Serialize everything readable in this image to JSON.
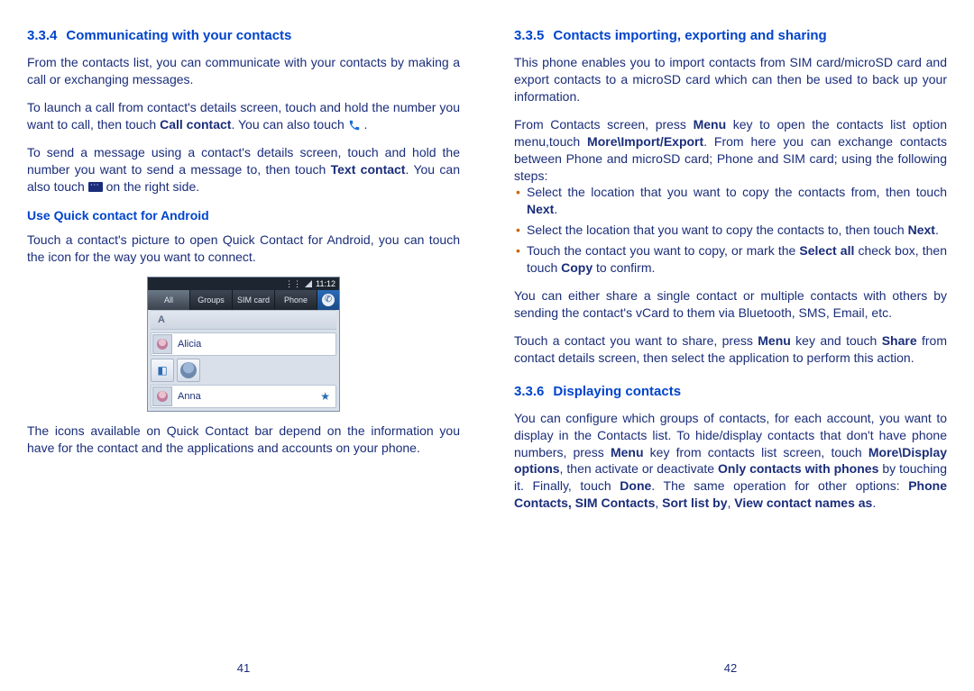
{
  "left": {
    "h_num": "3.3.4",
    "h_title": "Communicating with your contacts",
    "p1": "From the contacts list, you can communicate with your contacts by making a call or exchanging messages.",
    "p2a": "To launch a call from contact's details screen, touch and hold the number you want to call, then touch ",
    "p2b": "Call contact",
    "p2c": ". You can also touch ",
    "p2d": " .",
    "p3a": "To send a message using a contact's details screen, touch and hold the number you want to send a message to, then touch ",
    "p3b": "Text contact",
    "p3c": ". You can also touch ",
    "p3d": " on the right side.",
    "h4": "Use Quick contact for Android",
    "p4": "Touch a contact's picture to open Quick Contact for Android, you can touch the icon for the way you want to connect.",
    "p5": "The icons available on Quick Contact bar depend on the information you have for the contact and the applications and accounts on your phone.",
    "pageno": "41"
  },
  "shot": {
    "time": "11:12",
    "tabs": [
      "All",
      "Groups",
      "SIM card",
      "Phone"
    ],
    "letter": "A",
    "c1": "Alicia",
    "c2": "Anna"
  },
  "right": {
    "h1_num": "3.3.5",
    "h1_title": "Contacts importing, exporting and sharing",
    "p1": "This phone enables you to import contacts from SIM card/microSD card and export contacts to a microSD card which can then be used to back up your information.",
    "p2a": "From Contacts screen, press ",
    "p2b": "Menu",
    "p2c": " key to open the  contacts list option menu,touch ",
    "p2d": "More\\Import/Export",
    "p2e": ". From here you can exchange contacts between Phone and microSD card;  Phone and SIM card; using the  following steps:",
    "b1a": "Select the location that you want to copy the contacts from, then touch ",
    "b1b": "Next",
    "b1c": ".",
    "b2a": "Select the location that you want to copy the contacts to, then touch ",
    "b2b": "Next",
    "b2c": ".",
    "b3a": "Touch the contact you want to copy, or mark the ",
    "b3b": "Select all",
    "b3c": " check box, then touch ",
    "b3d": "Copy",
    "b3e": " to confirm.",
    "p3": "You can either share a single contact or multiple contacts with others by sending the contact's vCard to them via Bluetooth, SMS, Email, etc.",
    "p4a": "Touch a contact you want to share, press ",
    "p4b": "Menu",
    "p4c": " key and touch ",
    "p4d": "Share",
    "p4e": " from contact details screen, then select the application to perform this action.",
    "h2_num": "3.3.6",
    "h2_title": "Displaying contacts",
    "p5a": "You can configure which groups of contacts, for each account, you want to display in the Contacts list. To hide/display contacts that don't have phone numbers, press ",
    "p5b": "Menu",
    "p5c": " key from contacts list screen, touch ",
    "p5d": "More\\Display options",
    "p5e": ", then activate or deactivate ",
    "p5f": "Only contacts with phones",
    "p5g": " by touching it. Finally, touch ",
    "p5h": "Done",
    "p5i": ". The same operation for other options: ",
    "p5j": "Phone Contacts, SIM Contacts",
    "p5k": ", ",
    "p5l": "Sort list by",
    "p5m": ", ",
    "p5n": "View contact names as",
    "p5o": ".",
    "pageno": "42"
  }
}
